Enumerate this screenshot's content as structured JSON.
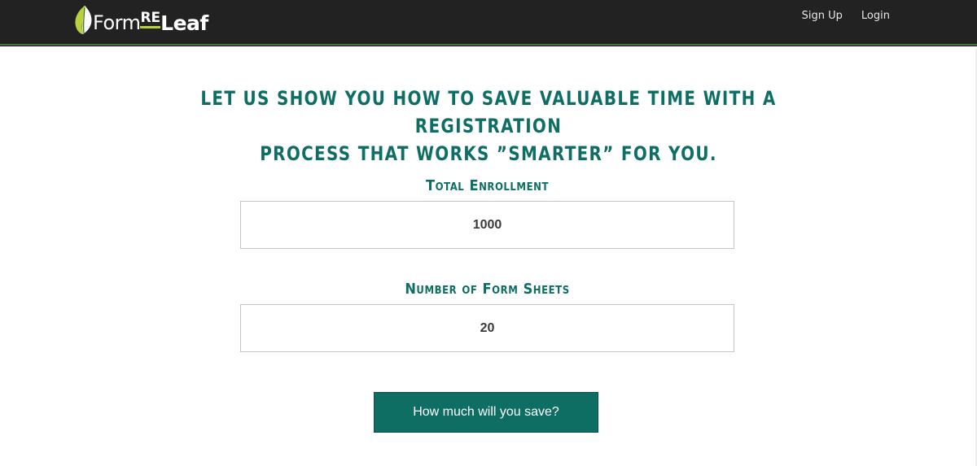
{
  "brand": {
    "part1": "Form",
    "part2": "RE",
    "part3": "Leaf",
    "colors": {
      "leaf_dark": "#3a6b1e",
      "leaf_light": "#b9d23c",
      "underline": "#b9d23c"
    }
  },
  "nav": {
    "links": [
      {
        "label": "Sign Up"
      },
      {
        "label": "Login"
      }
    ]
  },
  "hero": {
    "headline_line1": "Let us show you how to save valuable time with a registration",
    "headline_line2": "process that works ”smarter” for you."
  },
  "form": {
    "enrollment_label": "Total Enrollment",
    "enrollment_value": "1000",
    "sheets_label": "Number of Form Sheets",
    "sheets_value": "20",
    "submit_label": "How much will you save?"
  },
  "colors": {
    "accent": "#0e6e64",
    "navbar_bg": "#222222",
    "navbar_border": "#3f7a3a"
  }
}
